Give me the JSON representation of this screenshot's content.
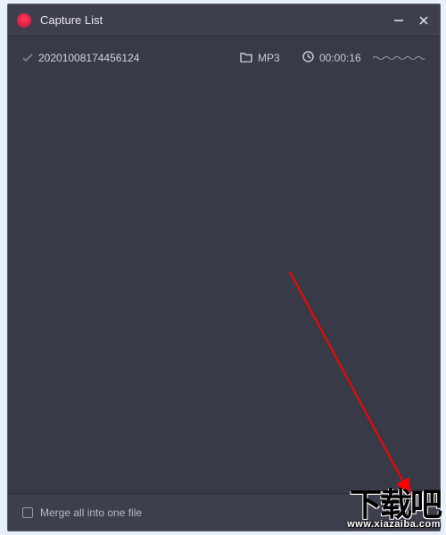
{
  "window": {
    "title": "Capture List"
  },
  "items": [
    {
      "filename": "20201008174456124",
      "format": "MP3",
      "duration": "00:00:16"
    }
  ],
  "footer": {
    "merge_label": "Merge all into one file"
  },
  "watermark": {
    "text": "下载吧",
    "url": "www.xiazaiba.com"
  }
}
